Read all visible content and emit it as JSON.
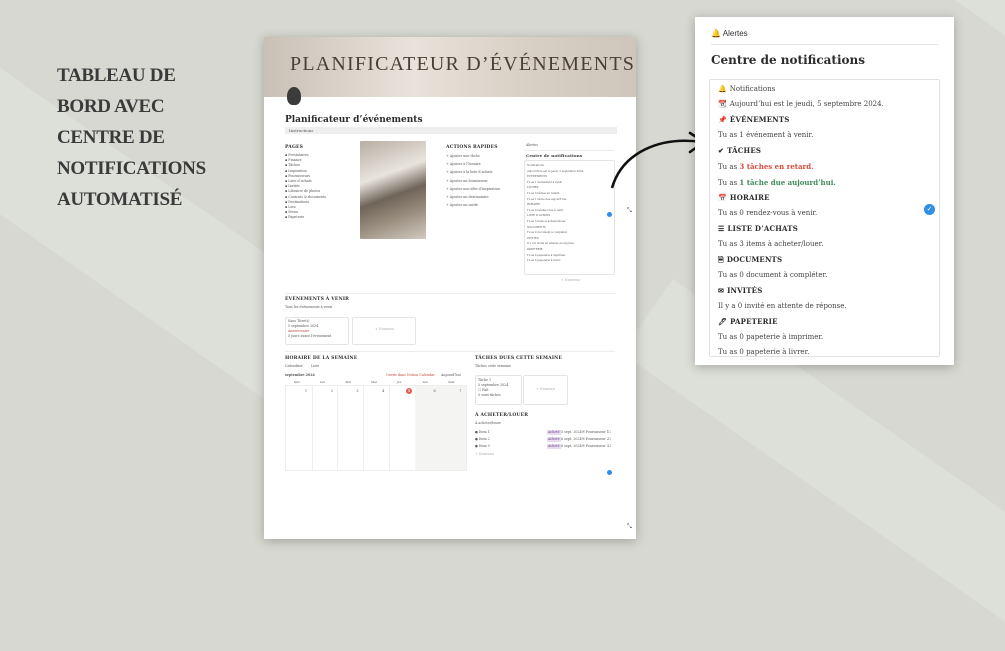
{
  "headline": [
    "TABLEAU DE",
    "BORD AVEC",
    "CENTRE DE",
    "NOTIFICATIONS",
    "AUTOMATISÉ"
  ],
  "page": {
    "banner_title": "PLANIFICATEUR D’ÉVÉNEMENTS",
    "title": "Planificateur d’événements",
    "subtitle": "Instructions",
    "pages_label": "PAGES",
    "pages_items": [
      "Prestataires",
      "Finance",
      "Tâches",
      "Inspiration",
      "Fournisseurs",
      "Liste d’achats",
      "Invités",
      "Librairie de photos",
      "Contrats & documents",
      "Destinations",
      "Lieu",
      "Menu",
      "Papeterie"
    ],
    "quick_label": "ACTIONS RAPIDES",
    "quick_items": [
      "Ajouter une tâche",
      "Ajouter à l’horaire",
      "Ajouter à la liste d’achats",
      "Ajouter un fournisseur",
      "Ajouter une idée d’inspiration",
      "Ajouter un destinataire",
      "Ajouter un invité"
    ],
    "mini_alerts": "Alertes",
    "mini_center": "Centre de notifications",
    "mini_center_items": [
      "Notifications",
      "Aujourd’hui est le jeudi, 5 septembre 2024.",
      "ÉVÉNEMENTS",
      "Tu as 1 événement à venir.",
      "TÂCHES",
      "Tu as 3 tâches en retard.",
      "Tu as 1 tâche due aujourd’hui.",
      "HORAIRE",
      "Tu as 0 rendez-vous à venir.",
      "LISTE D’ACHATS",
      "Tu as 3 items à acheter/louer.",
      "DOCUMENTS",
      "Tu as 0 document à compléter.",
      "INVITÉS",
      "Il y a 0 invité en attente de réponse.",
      "PAPETERIE",
      "Tu as 0 papeterie à imprimer.",
      "Tu as 0 papeterie à livrer."
    ],
    "mini_new": "+ Nouveau",
    "events_label": "ÉVÉNEMENTS À VENIR",
    "events_view": "Tous les événements à venir",
    "event_card": [
      "Sans Titre(s)",
      "5 septembre 2024",
      "Anniversaire",
      "5 jours avant l’événement"
    ],
    "event_new": "+ Nouveau",
    "schedule_label": "HORAIRE DE LA SEMAINE",
    "schedule_tabs": [
      "Calendrier",
      "Liste"
    ],
    "schedule_month": "septembre 2024",
    "schedule_controls": [
      "Ouvrir dans Notion Calendar",
      "Aujourd’hui"
    ],
    "calendar_days": [
      "Dim",
      "Lun",
      "Mar",
      "Mer",
      "Jeu",
      "Ven",
      "Sam"
    ],
    "calendar_dates": [
      "1",
      "2",
      "3",
      "4",
      "5",
      "6",
      "7"
    ],
    "tasks_label": "TÂCHES DUES CETTE SEMAINE",
    "tasks_view": "Tâches cette semaine",
    "task_card": [
      "Tâche 1",
      "5 septembre 2024",
      "Fait",
      "0 sous-tâches"
    ],
    "task_new": "+ Nouveau",
    "shop_label": "À ACHETER/LOUER",
    "shop_view": "À acheter/louer",
    "shop_items": [
      {
        "name": "Item 1",
        "tag": "Acheté",
        "date": "5 sept. 2024",
        "vendor": "Fournisseur 1"
      },
      {
        "name": "Item 2",
        "tag": "Acheté",
        "date": "6 sept. 2024",
        "vendor": "Fournisseur 2"
      },
      {
        "name": "Item 3",
        "tag": "Acheté",
        "date": "6 sept. 2024",
        "vendor": "Fournisseur 3"
      }
    ],
    "shop_new": "+ Nouveau"
  },
  "panel": {
    "header": "Alertes",
    "title": "Centre de notifications",
    "rows": [
      {
        "kind": "text",
        "icon": "bell-icon",
        "glyph": "🔔",
        "text": "Notifications"
      },
      {
        "kind": "text",
        "icon": "calendar-icon",
        "glyph": "📆",
        "text": "Aujourd’hui est le jeudi, 5 septembre 2024."
      },
      {
        "kind": "head",
        "icon": "pin-icon",
        "glyph": "📌",
        "text": "ÉVÉNEMENTS"
      },
      {
        "kind": "text",
        "text": "Tu as 1 événement à venir."
      },
      {
        "kind": "head",
        "icon": "checkmark-icon",
        "glyph": "✔",
        "text": "TÂCHES"
      },
      {
        "kind": "red",
        "text": "Tu as 3 tâches en retard.",
        "prefix": "Tu as ",
        "hl": "3 tâches en retard."
      },
      {
        "kind": "green",
        "text": "Tu as 1 tâche due aujourd’hui.",
        "prefix": "Tu as ",
        "hl": "1 tâche due aujourd’hui."
      },
      {
        "kind": "head",
        "icon": "calendar-icon",
        "glyph": "📅",
        "text": "HORAIRE"
      },
      {
        "kind": "text",
        "text": "Tu as 0 rendez-vous à venir."
      },
      {
        "kind": "head",
        "icon": "list-icon",
        "glyph": "☰",
        "text": "LISTE D’ACHATS"
      },
      {
        "kind": "text",
        "text": "Tu as 3 items à acheter/louer."
      },
      {
        "kind": "head",
        "icon": "document-icon",
        "glyph": "🗎",
        "text": "DOCUMENTS"
      },
      {
        "kind": "text",
        "text": "Tu as 0 document à compléter."
      },
      {
        "kind": "head",
        "icon": "envelope-icon",
        "glyph": "✉",
        "text": "INVITÉS"
      },
      {
        "kind": "text",
        "text": "Il y a 0 invité en attente de réponse."
      },
      {
        "kind": "head",
        "icon": "pen-icon",
        "glyph": "🖊",
        "text": "PAPETERIE"
      },
      {
        "kind": "text",
        "text": "Tu as 0 papeterie à imprimer."
      },
      {
        "kind": "text",
        "text": "Tu as 0 papeterie à livrer."
      }
    ],
    "colors": {
      "accent_blue": "#2f8ee8",
      "alert_red": "#d64a3a",
      "ok_green": "#3f8a5a"
    }
  }
}
